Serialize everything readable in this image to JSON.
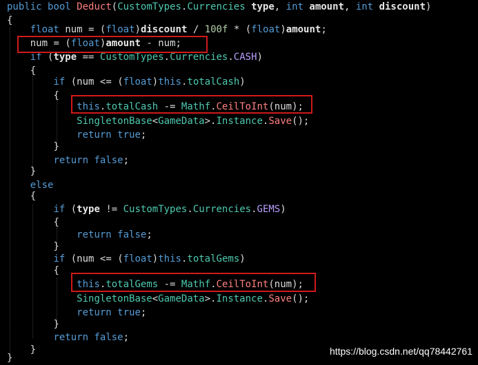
{
  "editor": {
    "lines": [
      [
        [
          "kw",
          "public"
        ],
        [
          "ws",
          " "
        ],
        [
          "kw",
          "bool"
        ],
        [
          "ws",
          " "
        ],
        [
          "fn",
          "Deduct"
        ],
        [
          "pu",
          "("
        ],
        [
          "ty",
          "CustomTypes"
        ],
        [
          "pu",
          "."
        ],
        [
          "ty",
          "Currencies"
        ],
        [
          "ws",
          " "
        ],
        [
          "pa",
          "type"
        ],
        [
          "pu",
          ", "
        ],
        [
          "kw",
          "int"
        ],
        [
          "ws",
          " "
        ],
        [
          "pa",
          "amount"
        ],
        [
          "pu",
          ", "
        ],
        [
          "kw",
          "int"
        ],
        [
          "ws",
          " "
        ],
        [
          "pa",
          "discount"
        ],
        [
          "pu",
          ")"
        ]
      ],
      [
        [
          "pu",
          "{"
        ]
      ],
      [
        [
          "ws",
          "    "
        ],
        [
          "kw",
          "float"
        ],
        [
          "ws",
          " "
        ],
        [
          "id",
          "num"
        ],
        [
          "ws",
          " "
        ],
        [
          "pu",
          "="
        ],
        [
          "ws",
          " "
        ],
        [
          "pu",
          "("
        ],
        [
          "kw",
          "float"
        ],
        [
          "pu",
          ")"
        ],
        [
          "pa",
          "discount"
        ],
        [
          "ws",
          " "
        ],
        [
          "pu",
          "/"
        ],
        [
          "ws",
          " "
        ],
        [
          "nu",
          "100f"
        ],
        [
          "ws",
          " "
        ],
        [
          "pu",
          "*"
        ],
        [
          "ws",
          " "
        ],
        [
          "pu",
          "("
        ],
        [
          "kw",
          "float"
        ],
        [
          "pu",
          ")"
        ],
        [
          "pa",
          "amount"
        ],
        [
          "pu",
          ";"
        ]
      ],
      [
        [
          "ws",
          "    "
        ],
        [
          "id",
          "num"
        ],
        [
          "ws",
          " "
        ],
        [
          "pu",
          "="
        ],
        [
          "ws",
          " "
        ],
        [
          "pu",
          "("
        ],
        [
          "kw",
          "float"
        ],
        [
          "pu",
          ")"
        ],
        [
          "pa",
          "amount"
        ],
        [
          "ws",
          " "
        ],
        [
          "pu",
          "-"
        ],
        [
          "ws",
          " "
        ],
        [
          "id",
          "num"
        ],
        [
          "pu",
          ";"
        ]
      ],
      [
        [
          "ws",
          "    "
        ],
        [
          "kw",
          "if"
        ],
        [
          "ws",
          " "
        ],
        [
          "pu",
          "("
        ],
        [
          "pa",
          "type"
        ],
        [
          "ws",
          " "
        ],
        [
          "pu",
          "=="
        ],
        [
          "ws",
          " "
        ],
        [
          "ty",
          "CustomTypes"
        ],
        [
          "pu",
          "."
        ],
        [
          "ty",
          "Currencies"
        ],
        [
          "pu",
          "."
        ],
        [
          "en",
          "CASH"
        ],
        [
          "pu",
          ")"
        ]
      ],
      [
        [
          "ws",
          "    "
        ],
        [
          "pu",
          "{"
        ]
      ],
      [
        [
          "ws",
          "        "
        ],
        [
          "kw",
          "if"
        ],
        [
          "ws",
          " "
        ],
        [
          "pu",
          "("
        ],
        [
          "id",
          "num"
        ],
        [
          "ws",
          " "
        ],
        [
          "pu",
          "<="
        ],
        [
          "ws",
          " "
        ],
        [
          "pu",
          "("
        ],
        [
          "kw",
          "float"
        ],
        [
          "pu",
          ")"
        ],
        [
          "kw",
          "this"
        ],
        [
          "pu",
          "."
        ],
        [
          "pr",
          "totalCash"
        ],
        [
          "pu",
          ")"
        ]
      ],
      [
        [
          "ws",
          "        "
        ],
        [
          "pu",
          "{"
        ]
      ],
      [
        [
          "ws",
          "            "
        ],
        [
          "kw",
          "this"
        ],
        [
          "pu",
          "."
        ],
        [
          "pr",
          "totalCash"
        ],
        [
          "ws",
          " "
        ],
        [
          "pu",
          "-="
        ],
        [
          "ws",
          " "
        ],
        [
          "ty",
          "Mathf"
        ],
        [
          "pu",
          "."
        ],
        [
          "fn",
          "CeilToInt"
        ],
        [
          "pu",
          "("
        ],
        [
          "id",
          "num"
        ],
        [
          "pu",
          ");"
        ]
      ],
      [
        [
          "ws",
          "            "
        ],
        [
          "ty",
          "SingletonBase"
        ],
        [
          "pu",
          "<"
        ],
        [
          "ty",
          "GameData"
        ],
        [
          "pu",
          ">."
        ],
        [
          "pr",
          "Instance"
        ],
        [
          "pu",
          "."
        ],
        [
          "fn",
          "Save"
        ],
        [
          "pu",
          "();"
        ]
      ],
      [
        [
          "ws",
          "            "
        ],
        [
          "kw",
          "return"
        ],
        [
          "ws",
          " "
        ],
        [
          "kw",
          "true"
        ],
        [
          "pu",
          ";"
        ]
      ],
      [
        [
          "ws",
          "        "
        ],
        [
          "pu",
          "}"
        ]
      ],
      [
        [
          "ws",
          "        "
        ],
        [
          "kw",
          "return"
        ],
        [
          "ws",
          " "
        ],
        [
          "kw",
          "false"
        ],
        [
          "pu",
          ";"
        ]
      ],
      [
        [
          "ws",
          "    "
        ],
        [
          "pu",
          "}"
        ]
      ],
      [
        [
          "ws",
          "    "
        ],
        [
          "kw",
          "else"
        ]
      ],
      [
        [
          "ws",
          "    "
        ],
        [
          "pu",
          "{"
        ]
      ],
      [
        [
          "ws",
          "        "
        ],
        [
          "kw",
          "if"
        ],
        [
          "ws",
          " "
        ],
        [
          "pu",
          "("
        ],
        [
          "pa",
          "type"
        ],
        [
          "ws",
          " "
        ],
        [
          "pu",
          "!="
        ],
        [
          "ws",
          " "
        ],
        [
          "ty",
          "CustomTypes"
        ],
        [
          "pu",
          "."
        ],
        [
          "ty",
          "Currencies"
        ],
        [
          "pu",
          "."
        ],
        [
          "en",
          "GEMS"
        ],
        [
          "pu",
          ")"
        ]
      ],
      [
        [
          "ws",
          "        "
        ],
        [
          "pu",
          "{"
        ]
      ],
      [
        [
          "ws",
          "            "
        ],
        [
          "kw",
          "return"
        ],
        [
          "ws",
          " "
        ],
        [
          "kw",
          "false"
        ],
        [
          "pu",
          ";"
        ]
      ],
      [
        [
          "ws",
          "        "
        ],
        [
          "pu",
          "}"
        ]
      ],
      [
        [
          "ws",
          "        "
        ],
        [
          "kw",
          "if"
        ],
        [
          "ws",
          " "
        ],
        [
          "pu",
          "("
        ],
        [
          "id",
          "num"
        ],
        [
          "ws",
          " "
        ],
        [
          "pu",
          "<="
        ],
        [
          "ws",
          " "
        ],
        [
          "pu",
          "("
        ],
        [
          "kw",
          "float"
        ],
        [
          "pu",
          ")"
        ],
        [
          "kw",
          "this"
        ],
        [
          "pu",
          "."
        ],
        [
          "pr",
          "totalGems"
        ],
        [
          "pu",
          ")"
        ]
      ],
      [
        [
          "ws",
          "        "
        ],
        [
          "pu",
          "{"
        ]
      ],
      [
        [
          "ws",
          "            "
        ],
        [
          "kw",
          "this"
        ],
        [
          "pu",
          "."
        ],
        [
          "pr",
          "totalGems"
        ],
        [
          "ws",
          " "
        ],
        [
          "pu",
          "-="
        ],
        [
          "ws",
          " "
        ],
        [
          "ty",
          "Mathf"
        ],
        [
          "pu",
          "."
        ],
        [
          "fn",
          "CeilToInt"
        ],
        [
          "pu",
          "("
        ],
        [
          "id",
          "num"
        ],
        [
          "pu",
          ");"
        ]
      ],
      [
        [
          "ws",
          "            "
        ],
        [
          "ty",
          "SingletonBase"
        ],
        [
          "pu",
          "<"
        ],
        [
          "ty",
          "GameData"
        ],
        [
          "pu",
          ">."
        ],
        [
          "pr",
          "Instance"
        ],
        [
          "pu",
          "."
        ],
        [
          "fn",
          "Save"
        ],
        [
          "pu",
          "();"
        ]
      ],
      [
        [
          "ws",
          "            "
        ],
        [
          "kw",
          "return"
        ],
        [
          "ws",
          " "
        ],
        [
          "kw",
          "true"
        ],
        [
          "pu",
          ";"
        ]
      ],
      [
        [
          "ws",
          "        "
        ],
        [
          "pu",
          "}"
        ]
      ],
      [
        [
          "ws",
          "        "
        ],
        [
          "kw",
          "return"
        ],
        [
          "ws",
          " "
        ],
        [
          "kw",
          "false"
        ],
        [
          "pu",
          ";"
        ]
      ],
      [
        [
          "ws",
          "    "
        ],
        [
          "pu",
          "}"
        ]
      ],
      [
        [
          "pu",
          "}"
        ]
      ]
    ]
  },
  "colors": {
    "background": "#000000",
    "keyword": "#569cd6",
    "type": "#4ec9b0",
    "method": "#ff8080",
    "enum_member": "#b8a0ff",
    "highlight_box": "#d11a1a"
  },
  "watermark": {
    "text": "https://blog.csdn.net/qq78442761"
  }
}
